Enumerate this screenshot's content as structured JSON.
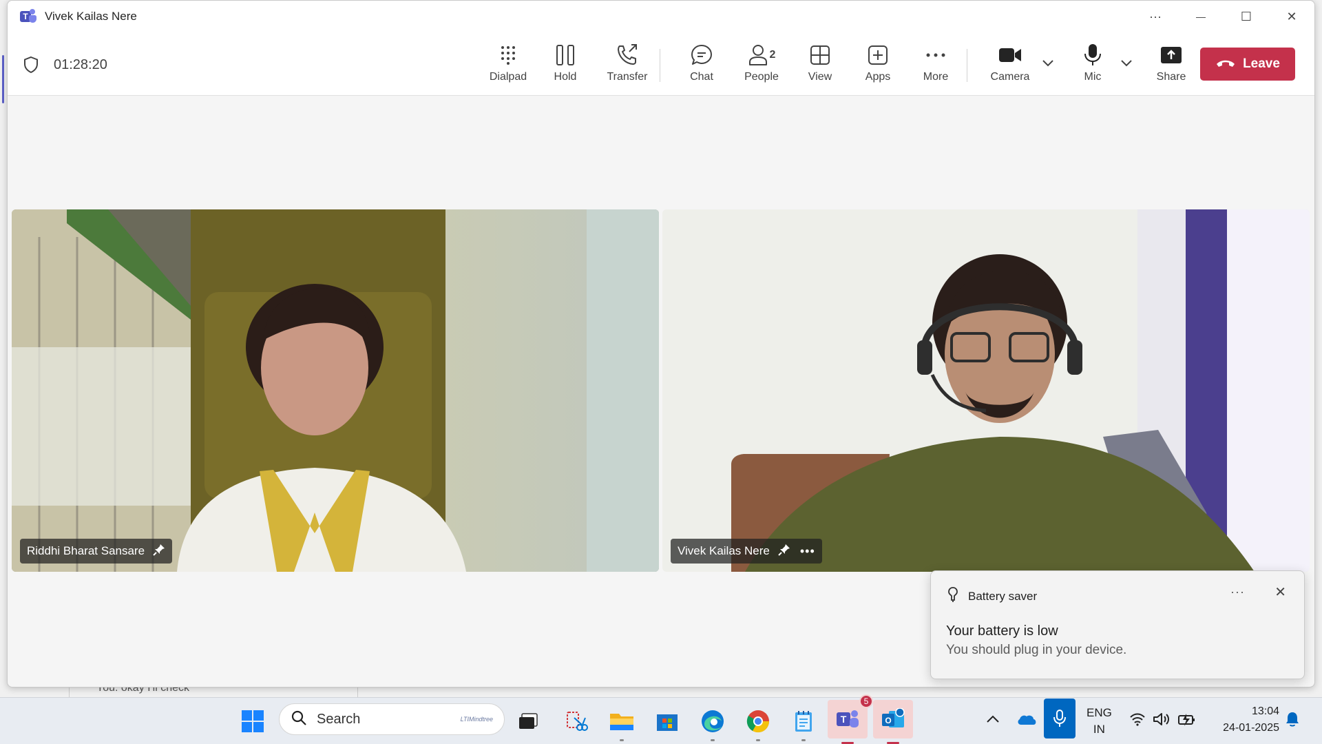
{
  "window": {
    "title": "Vivek Kailas Nere",
    "controls": {
      "more": "···",
      "minimize": "—",
      "maximize": "☐",
      "close": "✕"
    }
  },
  "call": {
    "timer": "01:28:20",
    "toolbar": {
      "dialpad": "Dialpad",
      "hold": "Hold",
      "transfer": "Transfer",
      "chat": "Chat",
      "people": "People",
      "people_count": "2",
      "view": "View",
      "apps": "Apps",
      "more": "More",
      "camera": "Camera",
      "mic": "Mic",
      "share": "Share",
      "leave": "Leave"
    }
  },
  "participants": [
    {
      "name": "Riddhi Bharat Sansare"
    },
    {
      "name": "Vivek Kailas Nere"
    }
  ],
  "background_app": {
    "chat_preview": "You: okay I'll check"
  },
  "notification": {
    "app": "Battery saver",
    "more": "···",
    "title": "Your battery is low",
    "body": "You should plug in your device."
  },
  "taskbar": {
    "search_placeholder": "Search",
    "search_brand": "LTIMindtree",
    "teams_badge": "5",
    "language": "ENG",
    "region": "IN",
    "time": "13:04",
    "date": "24-01-2025"
  },
  "colors": {
    "leave_red": "#c4314b",
    "teams_purple": "#4b53bc",
    "tray_mic_blue": "#0067c0"
  }
}
